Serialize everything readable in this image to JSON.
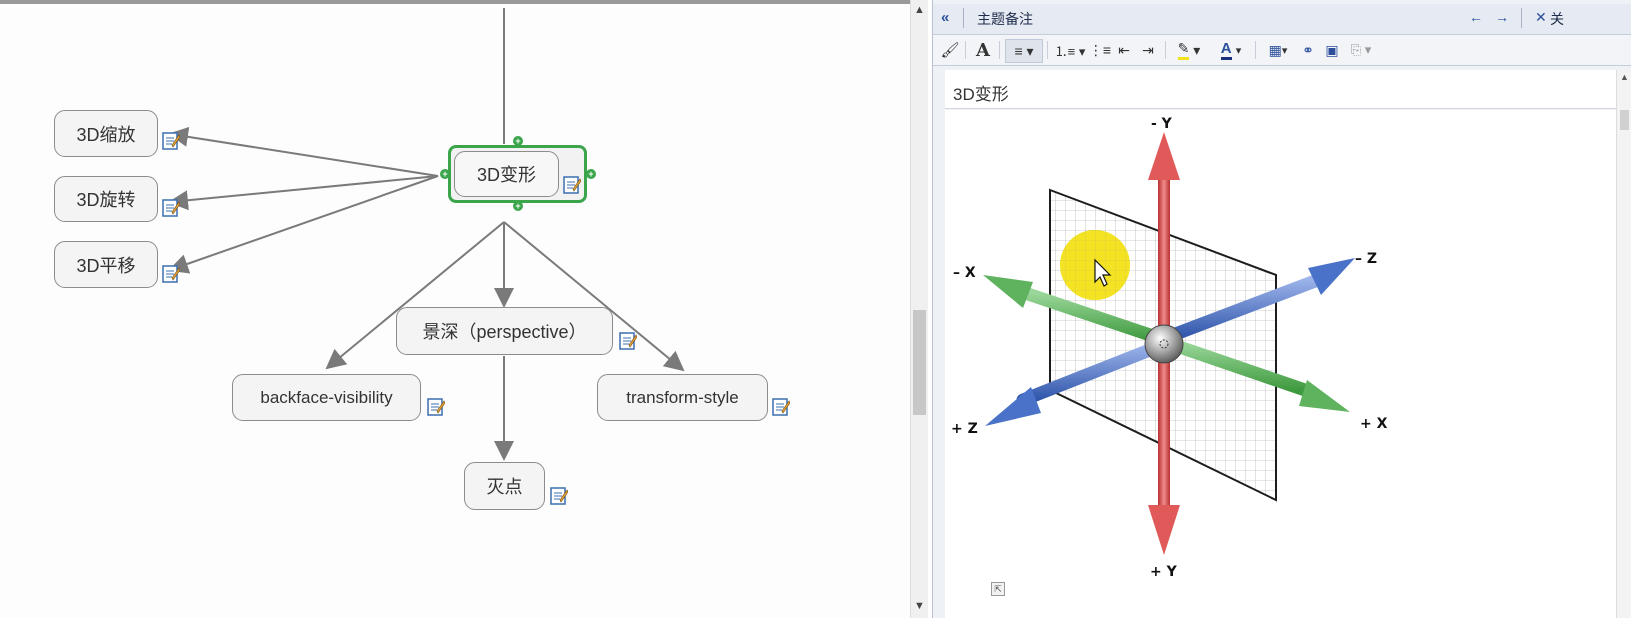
{
  "mindmap": {
    "central": "3D变形",
    "left_nodes": [
      "3D缩放",
      "3D旋转",
      "3D平移"
    ],
    "child_middle": "景深（perspective）",
    "child_left": "backface-visibility",
    "child_right": "transform-style",
    "grandchild": "灭点"
  },
  "panel": {
    "title": "主题备注",
    "close_label": "关",
    "note_title": "3D变形"
  },
  "diagram": {
    "labels": {
      "neg_y": "- Y",
      "pos_y": "+ Y",
      "neg_x": "– X",
      "pos_x": "+ X",
      "neg_z": "– Z",
      "pos_z": "+ Z"
    },
    "colors": {
      "y_axis": "#e05a5a",
      "x_axis": "#5fb35f",
      "z_axis": "#4a72c8",
      "highlight": "#f2e21a"
    }
  },
  "colors": {
    "selection": "#3aa54a",
    "node_border": "#8c8c8c"
  }
}
